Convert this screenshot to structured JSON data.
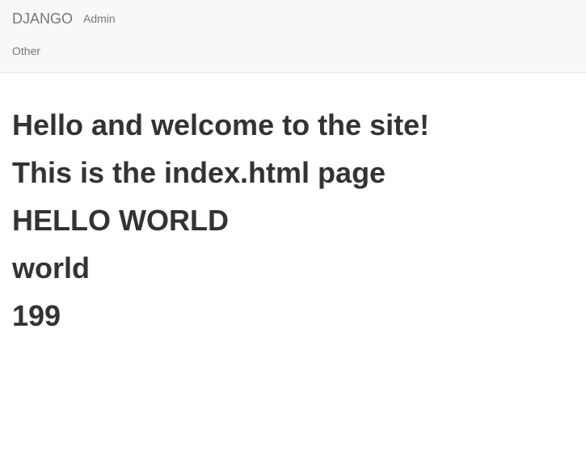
{
  "navbar": {
    "brand": "DJANGO",
    "links": {
      "admin": "Admin",
      "other": "Other"
    }
  },
  "main": {
    "lines": [
      "Hello and welcome to the site!",
      "This is the index.html page",
      "HELLO WORLD",
      "world",
      "199"
    ]
  },
  "colors": {
    "navbar_bg": "#f8f8f8",
    "navbar_text": "#777777",
    "body_text": "#333333"
  }
}
